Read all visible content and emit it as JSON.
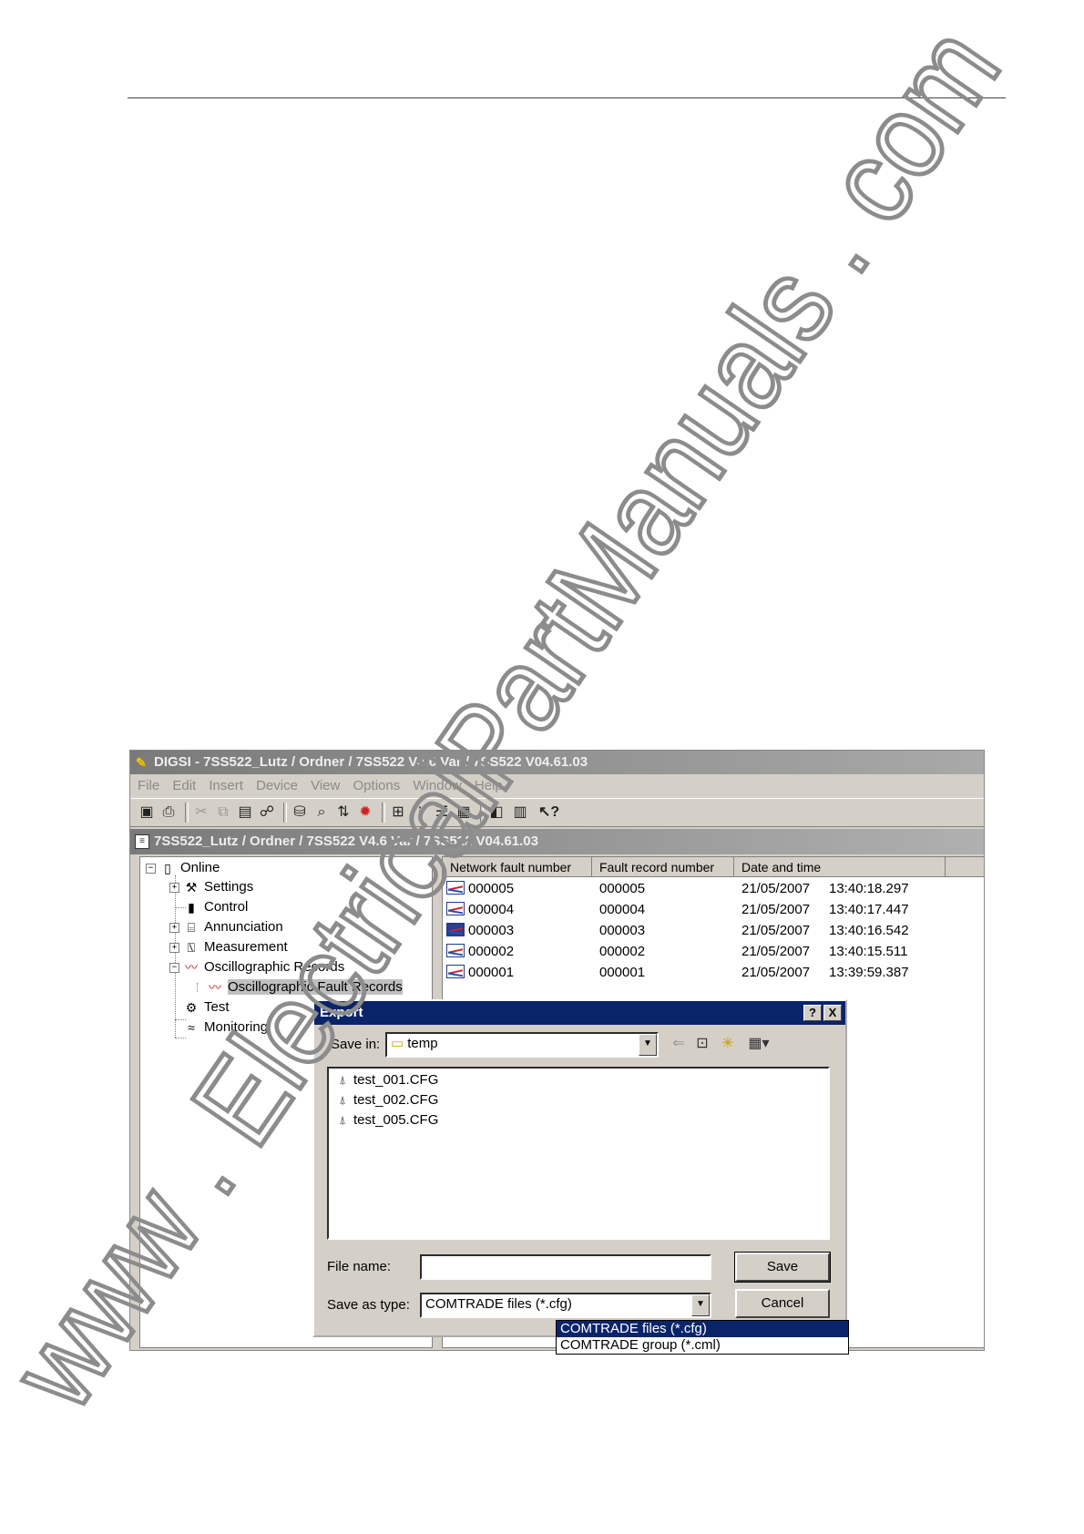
{
  "window": {
    "title": "DIGSI - 7SS522_Lutz / Ordner / 7SS522 V4.6 Var / 7SS522 V04.61.03",
    "menu": [
      "File",
      "Edit",
      "Insert",
      "Device",
      "View",
      "Options",
      "Window",
      "Help"
    ]
  },
  "child_window": {
    "title": "7SS522_Lutz / Ordner / 7SS522 V4.6 Var / 7SS522 V04.61.03"
  },
  "tree": {
    "items": [
      {
        "label": "Online"
      },
      {
        "label": "Settings"
      },
      {
        "label": "Control"
      },
      {
        "label": "Annunciation"
      },
      {
        "label": "Measurement"
      },
      {
        "label": "Oscillographic Records"
      },
      {
        "label": "Oscillographic Fault Records"
      },
      {
        "label": "Test"
      },
      {
        "label": "Monitoring"
      }
    ]
  },
  "list": {
    "columns": [
      "Network fault number",
      "Fault record number",
      "Date and time"
    ],
    "rows": [
      {
        "network": "000005",
        "record": "000005",
        "date": "21/05/2007",
        "time": "13:40:18.297"
      },
      {
        "network": "000004",
        "record": "000004",
        "date": "21/05/2007",
        "time": "13:40:17.447"
      },
      {
        "network": "000003",
        "record": "000003",
        "date": "21/05/2007",
        "time": "13:40:16.542"
      },
      {
        "network": "000002",
        "record": "000002",
        "date": "21/05/2007",
        "time": "13:40:15.511"
      },
      {
        "network": "000001",
        "record": "000001",
        "date": "21/05/2007",
        "time": "13:39:59.387"
      }
    ]
  },
  "dialog": {
    "title": "Export",
    "help_btn": "?",
    "close_btn": "X",
    "save_in_label": "Save in:",
    "save_in_value": "temp",
    "files": [
      "test_001.CFG",
      "test_002.CFG",
      "test_005.CFG"
    ],
    "file_name_label": "File name:",
    "file_name_value": "",
    "save_as_label": "Save as type:",
    "save_as_value": "COMTRADE files (*.cfg)",
    "save_button": "Save",
    "cancel_button": "Cancel",
    "type_options": [
      "COMTRADE files (*.cfg)",
      "COMTRADE group (*.cml)"
    ]
  },
  "watermark": {
    "text": "www . ElectricalPartManuals . com",
    "color": "#8c8c8c"
  }
}
